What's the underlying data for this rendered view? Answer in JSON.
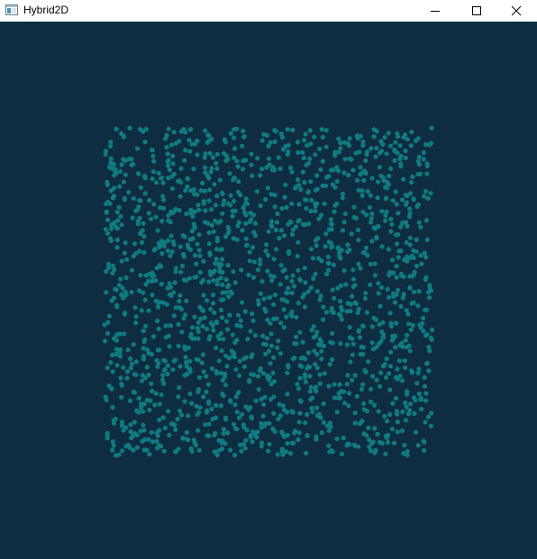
{
  "window": {
    "title": "Hybrid2D",
    "controls": {
      "minimize_icon": "minimize-icon",
      "maximize_icon": "maximize-icon",
      "close_icon": "close-icon"
    }
  },
  "scene": {
    "background_color": "#0f2d40",
    "particle_color": "#0f7b80"
  }
}
